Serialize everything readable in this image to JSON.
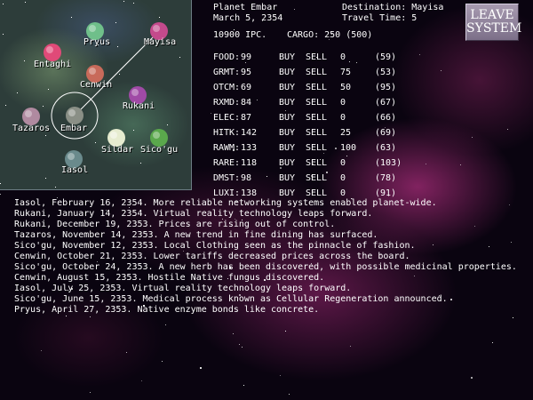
{
  "header": {
    "planet": "Planet Embar",
    "date": "March 5, 2354",
    "destination": "Destination: Mayisa",
    "travel_time": "Travel Time: 5",
    "credits": "10900 IPC.",
    "cargo": "CARGO: 250  (500)"
  },
  "leave_button": {
    "line1": "LEAVE",
    "line2": "SYSTEM"
  },
  "market_actions": {
    "buy": "BUY",
    "sell": "SELL"
  },
  "market": [
    {
      "code": "FOOD",
      "price": "99",
      "held": "0",
      "avg": "(59)"
    },
    {
      "code": "GRMT",
      "price": "95",
      "held": "75",
      "avg": "(53)"
    },
    {
      "code": "OTCM",
      "price": "69",
      "held": "50",
      "avg": "(95)"
    },
    {
      "code": "RXMD",
      "price": "84",
      "held": "0",
      "avg": "(67)"
    },
    {
      "code": "ELEC",
      "price": "87",
      "held": "0",
      "avg": "(66)"
    },
    {
      "code": "HITK",
      "price": "142",
      "held": "25",
      "avg": "(69)"
    },
    {
      "code": "RAWM",
      "price": "133",
      "held": "100",
      "avg": "(63)"
    },
    {
      "code": "RARE",
      "price": "118",
      "held": "0",
      "avg": "(103)"
    },
    {
      "code": "DMST",
      "price": "98",
      "held": "0",
      "avg": "(78)"
    },
    {
      "code": "LUXI",
      "price": "138",
      "held": "0",
      "avg": "(91)"
    }
  ],
  "planets": [
    {
      "name": "Pryus",
      "color": "#6fbf8a"
    },
    {
      "name": "Mayisa",
      "color": "#c44a8c"
    },
    {
      "name": "Entaghi",
      "color": "#e04a78"
    },
    {
      "name": "Cenwin",
      "color": "#c86a5a"
    },
    {
      "name": "Rukani",
      "color": "#a04aa6"
    },
    {
      "name": "Tazaros",
      "color": "#b08aa0"
    },
    {
      "name": "Embar",
      "color": "#8a8f86"
    },
    {
      "name": "Sildar",
      "color": "#e6ecd0"
    },
    {
      "name": "Sico'gu",
      "color": "#5aa84c"
    },
    {
      "name": "Iasol",
      "color": "#6a8a8c"
    }
  ],
  "news": [
    "Iasol, February 16, 2354.  More reliable networking systems enabled planet-wide.",
    "Rukani, January 14, 2354.  Virtual reality technology leaps forward.",
    "Rukani, December 19, 2353.  Prices are rising out of control.",
    "Tazaros, November 14, 2353.  A new trend in fine dining has surfaced.",
    "Sico'gu, November 12, 2353.  Local Clothing seen as the pinnacle of fashion.",
    "Cenwin, October 21, 2353.  Lower tariffs decreased prices across the board.",
    "Sico'gu, October 24, 2353.  A new herb has been discovered, with possible medicinal properties.",
    "Cenwin, August 15, 2353.  Hostile Native fungus discovered.",
    "Iasol, July 25, 2353.  Virtual reality technology leaps forward.",
    "Sico'gu, June 15, 2353.  Medical process known as Cellular Regeneration announced.",
    "Pryus, April 27, 2353.  Native enzyme bonds like concrete."
  ]
}
